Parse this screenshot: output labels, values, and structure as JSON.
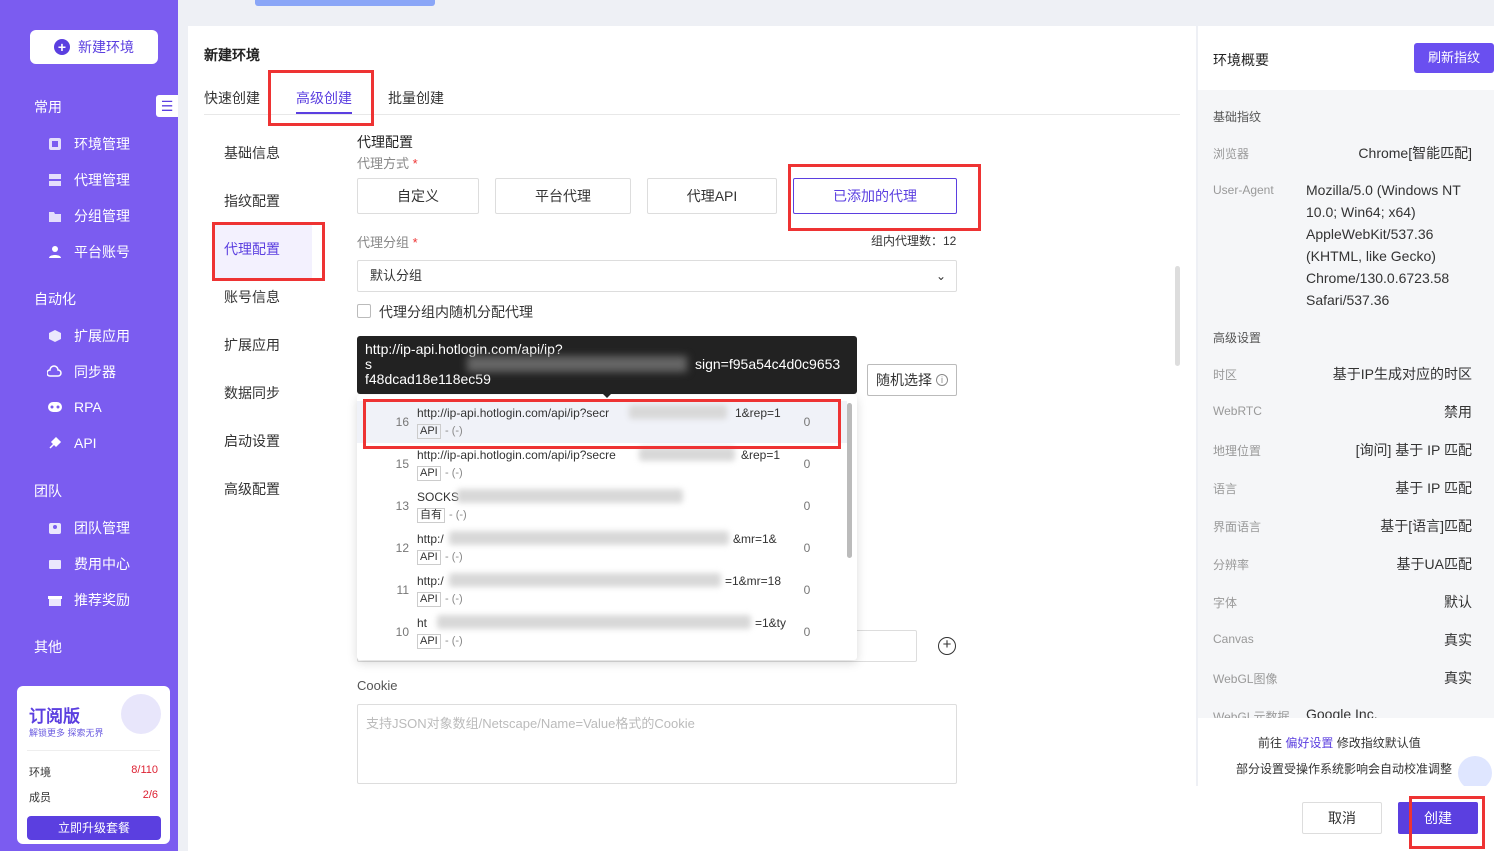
{
  "sidebar": {
    "new_env": "新建环境",
    "sections": {
      "common": "常用",
      "automation": "自动化",
      "team": "团队",
      "other": "其他"
    },
    "items": {
      "env": "环境管理",
      "proxy": "代理管理",
      "group": "分组管理",
      "account": "平台账号",
      "ext": "扩展应用",
      "sync": "同步器",
      "rpa": "RPA",
      "api": "API",
      "team": "团队管理",
      "fee": "费用中心",
      "reward": "推荐奖励"
    },
    "subscription": {
      "title": "订阅版",
      "subtitle": "解锁更多 探索无界",
      "env_label": "环境",
      "env_value": "8/110",
      "member_label": "成员",
      "member_value": "2/6",
      "upgrade": "立即升级套餐"
    }
  },
  "main": {
    "title": "新建环境",
    "tabs": [
      "快速创建",
      "高级创建",
      "批量创建"
    ],
    "left_nav": [
      "基础信息",
      "指纹配置",
      "代理配置",
      "账号信息",
      "扩展应用",
      "数据同步",
      "启动设置",
      "高级配置"
    ],
    "section_title": "代理配置",
    "proxy_method_label": "代理方式",
    "required_mark": "*",
    "proxy_methods": [
      "自定义",
      "平台代理",
      "代理API",
      "已添加的代理"
    ],
    "proxy_group_label": "代理分组",
    "group_count": "组内代理数：12",
    "group_select": "默认分组",
    "random_assign": "代理分组内随机分配代理",
    "random_select": "随机选择",
    "cookie_label": "Cookie",
    "cookie_placeholder": "支持JSON对象数组/Netscape/Name=Value格式的Cookie"
  },
  "tooltip": {
    "line1": "http://ip-api.hotlogin.com/api/ip?",
    "line2a": "s",
    "line2b": "sign=f95a54c4d0c9653",
    "line3": "f48dcad18e118ec59"
  },
  "proxies": [
    {
      "id": "16",
      "url_a": "http://ip-api.hotlogin.com/api/ip?secr",
      "url_b": "1&rep=1",
      "tag": "API",
      "tag_txt": "- (-)",
      "count": "0"
    },
    {
      "id": "15",
      "url_a": "http://ip-api.hotlogin.com/api/ip?secre",
      "url_b": "&rep=1",
      "tag": "API",
      "tag_txt": "- (-)",
      "count": "0"
    },
    {
      "id": "13",
      "url_a": "SOCKS",
      "url_b": "",
      "tag": "自有",
      "tag_txt": "- (-)",
      "count": "0"
    },
    {
      "id": "12",
      "url_a": "http:/",
      "url_b": "&mr=1&",
      "tag": "API",
      "tag_txt": "- (-)",
      "count": "0"
    },
    {
      "id": "11",
      "url_a": "http:/",
      "url_b": "=1&mr=18",
      "tag": "API",
      "tag_txt": "- (-)",
      "count": "0"
    },
    {
      "id": "10",
      "url_a": "ht",
      "url_b": "=1&ty",
      "tag": "API",
      "tag_txt": "- (-)",
      "count": "0"
    }
  ],
  "overview": {
    "title": "环境概要",
    "refresh": "刷新指纹",
    "basic_section": "基础指纹",
    "browser_k": "浏览器",
    "browser_v": "Chrome[智能匹配]",
    "ua_k": "User-Agent",
    "ua_v": "Mozilla/5.0 (Windows NT 10.0; Win64; x64) AppleWebKit/537.36 (KHTML, like Gecko) Chrome/130.0.6723.58 Safari/537.36",
    "adv_section": "高级设置",
    "rows": [
      {
        "k": "时区",
        "v": "基于IP生成对应的时区"
      },
      {
        "k": "WebRTC",
        "v": "禁用"
      },
      {
        "k": "地理位置",
        "v": "[询问] 基于 IP 匹配"
      },
      {
        "k": "语言",
        "v": "基于 IP 匹配"
      },
      {
        "k": "界面语言",
        "v": "基于[语言]匹配"
      },
      {
        "k": "分辨率",
        "v": "基于UA匹配"
      },
      {
        "k": "字体",
        "v": "默认"
      },
      {
        "k": "Canvas",
        "v": "真实"
      },
      {
        "k": "WebGL图像",
        "v": "真实"
      },
      {
        "k": "WebGL元数据",
        "v": "Google Inc."
      }
    ],
    "foot_pre": "前往",
    "foot_link": "偏好设置",
    "foot_post": "修改指纹默认值",
    "foot_note": "部分设置受操作系统影响会自动校准调整"
  },
  "actions": {
    "cancel": "取消",
    "create": "创建"
  },
  "colors": {
    "brand": "#5b3fe0",
    "sidebar": "#7b5cf0",
    "highlight": "#e33333"
  }
}
